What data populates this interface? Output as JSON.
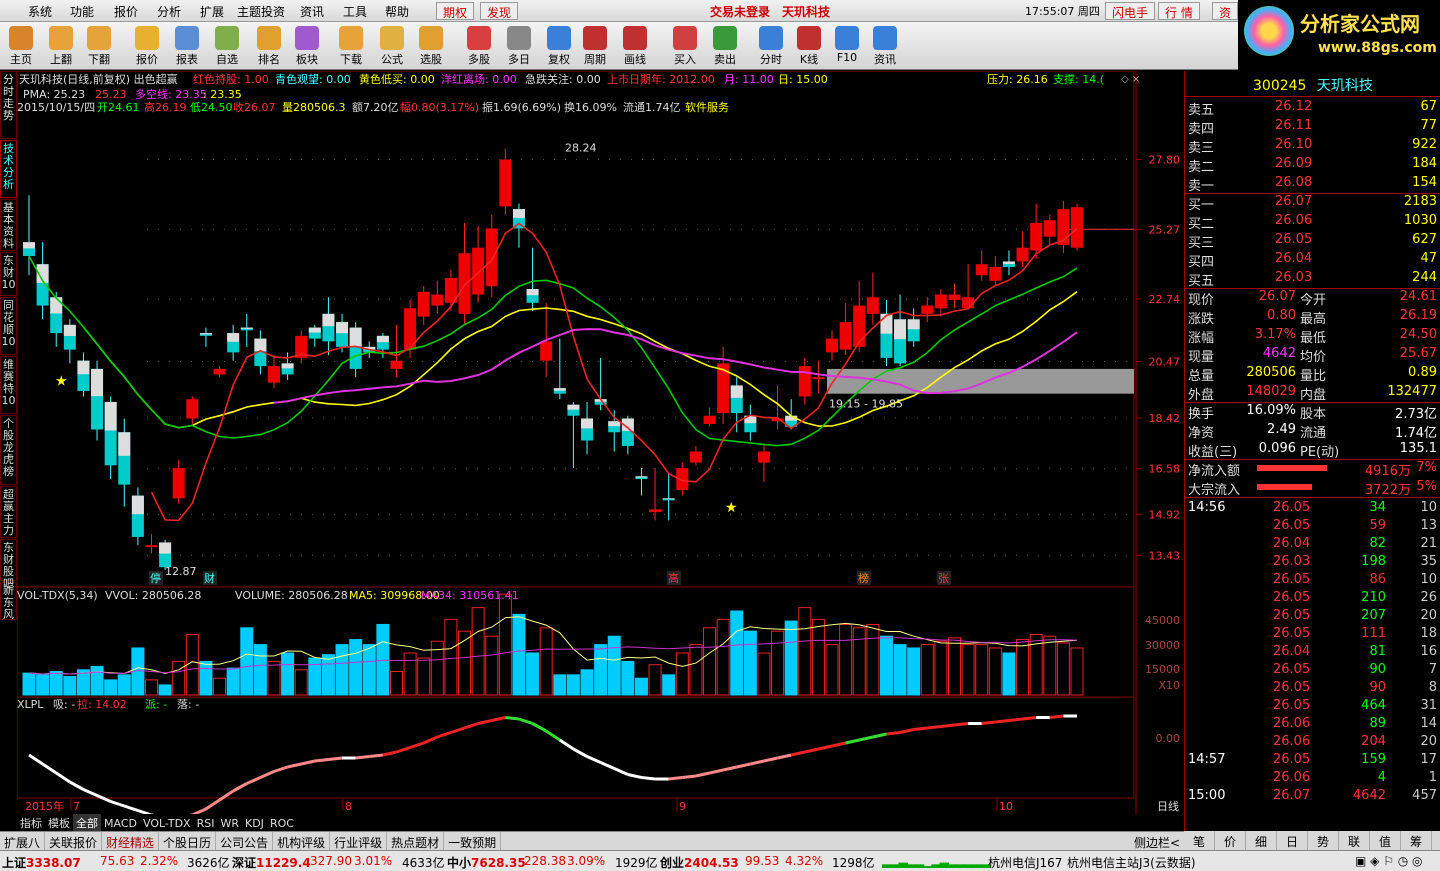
{
  "menu": {
    "items": [
      "系统",
      "功能",
      "报价",
      "分析",
      "扩展",
      "主题投资",
      "资讯",
      "工具",
      "帮助"
    ],
    "qq": "期权",
    "fx": "发现",
    "login": "交易未登录",
    "stock": "天玑科技",
    "time": "17:55:07 周四",
    "btn1": "闪电手",
    "btn2": "行 情",
    "btn3": "资"
  },
  "toolbar": [
    "主页",
    "上翻",
    "下翻",
    "报价",
    "报表",
    "自选",
    "排名",
    "板块",
    "下载",
    "公式",
    "选股",
    "多股",
    "多日",
    "复权",
    "周期",
    "画线",
    "买入",
    "卖出",
    "分时",
    "K线",
    "F10",
    "资讯"
  ],
  "logo": {
    "title": "分析家公式网",
    "url": "www.88gs.com"
  },
  "left_tabs": [
    "分时走势",
    "技术分析",
    "基本资料",
    "东财10",
    "同花顺10",
    "维赛特10",
    "个股龙虎榜",
    "超赢主力",
    "东财股吧",
    "新东风"
  ],
  "header": {
    "line1": "天玑科技(日线,前复权) 出色超赢",
    "hold": "红色持股: 1.00",
    "watch": "青色观望: 0.00",
    "low": "黄色低买: 0.00",
    "warn": "洋红离场: 0.00",
    "jump": "急跌关注: 0.00",
    "ipo": "上市日期年: 2012.00",
    "month": "月: 11.00",
    "day": "日: 15.00",
    "pressure": "压力: 26.16",
    "support": "支撑: 14.(",
    "pma": "PMA: 25.23",
    "v2": "25.23",
    "dk": "多空线: 23.35",
    "dk2": ": 23.35"
  },
  "infoline": {
    "date": "2015/10/15/四",
    "open": "开24.61",
    "high": "高26.19",
    "low": "低24.50",
    "close": "收26.07",
    "vol": "量280506.3",
    "amt": "额7.20亿",
    "pct": "幅0.80(3.17%)",
    "amp": "振1.69(6.69%)",
    "turn": "换16.09%",
    "float": "流通1.74亿",
    "sector": "软件服务"
  },
  "axis_prices": [
    "27.80",
    "25.27",
    "22.74",
    "20.47",
    "18.42",
    "16.58",
    "14.92",
    "13.43"
  ],
  "annotations": {
    "top": "28.24",
    "bottom": "12.87",
    "zone": "19.15 - 19.85",
    "marks": [
      "停",
      "财",
      "高",
      "榜",
      "张"
    ]
  },
  "vol_header": {
    "title": "VOL-TDX(5,34)",
    "vvol": "VVOL: 280506.28",
    "volume": "VOLUME: 280506.28",
    "ma5": "MA5: 309968.00",
    "ma34": "MA34: 310561.41"
  },
  "vol_axis": [
    "45000",
    "30000",
    "15000",
    "X10"
  ],
  "xlpl_header": {
    "title": "XLPL",
    "xi": "吸: -",
    "la": "拉: 14.02",
    "pai": "派: -",
    "luo": "落: -"
  },
  "xlpl_axis": "0.00",
  "date_axis": [
    "2015年",
    "7",
    "8",
    "9",
    "10"
  ],
  "date_label": "日线",
  "quote": {
    "code": "300245",
    "name": "天玑科技",
    "asks": [
      [
        "卖五",
        "26.12",
        "67"
      ],
      [
        "卖四",
        "26.11",
        "77"
      ],
      [
        "卖三",
        "26.10",
        "922"
      ],
      [
        "卖二",
        "26.09",
        "184"
      ],
      [
        "卖一",
        "26.08",
        "154"
      ]
    ],
    "bids": [
      [
        "买一",
        "26.07",
        "2183"
      ],
      [
        "买二",
        "26.06",
        "1030"
      ],
      [
        "买三",
        "26.05",
        "627"
      ],
      [
        "买四",
        "26.04",
        "47"
      ],
      [
        "买五",
        "26.03",
        "244"
      ]
    ],
    "stats": [
      [
        "现价",
        "26.07",
        "今开",
        "24.61"
      ],
      [
        "涨跌",
        "0.80",
        "最高",
        "26.19"
      ],
      [
        "涨幅",
        "3.17%",
        "最低",
        "24.50"
      ],
      [
        "现量",
        "4642",
        "均价",
        "25.67"
      ],
      [
        "总量",
        "280506",
        "量比",
        "0.89"
      ],
      [
        "外盘",
        "148029",
        "内盘",
        "132477"
      ]
    ],
    "stats2": [
      [
        "换手",
        "16.09%",
        "股本",
        "2.73亿"
      ],
      [
        "净资",
        "2.49",
        "流通",
        "1.74亿"
      ],
      [
        "收益(三)",
        "0.096",
        "PE(动)",
        "135.1"
      ]
    ],
    "flows": [
      [
        "净流入额",
        "4916万",
        "7%"
      ],
      [
        "大宗流入",
        "3722万",
        "5%"
      ]
    ],
    "ticks": [
      [
        "14:56",
        "26.05",
        "34",
        "10"
      ],
      [
        "",
        "26.05",
        "59",
        "13"
      ],
      [
        "",
        "26.04",
        "82",
        "21"
      ],
      [
        "",
        "26.03",
        "198",
        "35"
      ],
      [
        "",
        "26.05",
        "86",
        "10"
      ],
      [
        "",
        "26.05",
        "210",
        "26"
      ],
      [
        "",
        "26.05",
        "207",
        "20"
      ],
      [
        "",
        "26.05",
        "111",
        "18"
      ],
      [
        "",
        "26.04",
        "81",
        "16"
      ],
      [
        "",
        "26.05",
        "90",
        "7"
      ],
      [
        "",
        "26.05",
        "90",
        "8"
      ],
      [
        "",
        "26.05",
        "464",
        "31"
      ],
      [
        "",
        "26.06",
        "89",
        "14"
      ],
      [
        "",
        "26.06",
        "204",
        "20"
      ],
      [
        "14:57",
        "26.05",
        "159",
        "17"
      ],
      [
        "",
        "26.06",
        "4",
        "1"
      ],
      [
        "15:00",
        "26.07",
        "4642",
        "457"
      ]
    ]
  },
  "bottom_tabs": [
    "指标",
    "模板",
    "全部",
    "MACD",
    "VOL-TDX",
    "RSI",
    "WR",
    "KDJ",
    "ROC"
  ],
  "func_tabs": [
    "扩展八",
    "关联报价",
    "财经精选",
    "个股日历",
    "公司公告",
    "机构评级",
    "行业评级",
    "热点题材",
    "一致预期"
  ],
  "side_label": "侧边栏<",
  "right_tabs": [
    "笔",
    "价",
    "细",
    "日",
    "势",
    "联",
    "值",
    "筹"
  ],
  "status": {
    "sh": "上证",
    "sh_v": "3338.07",
    "sh_c": "75.63",
    "sh_p": "2.32%",
    "sh_a": "3626亿",
    "sz": "深证",
    "sz_v": "11229.4",
    "sz_c": "327.90",
    "sz_p": "3.01%",
    "sz_a": "4633亿",
    "zx": "中小",
    "zx_v": "7628.35",
    "zx_c": "228.38",
    "zx_p": "3.09%",
    "zx_a": "1929亿",
    "cy": "创业",
    "cy_v": "2404.53",
    "cy_c": "99.53",
    "cy_p": "4.32%",
    "cy_a": "1298亿",
    "srv1": "杭州电信J167",
    "srv2": "杭州电信主站J3(云数据)"
  },
  "chart_data": {
    "type": "candlestick",
    "price_range": [
      12.5,
      29.2
    ],
    "candles": [
      [
        24.8,
        24.3,
        26.5,
        23.6,
        "c"
      ],
      [
        24.0,
        22.5,
        24.8,
        22.0,
        "c"
      ],
      [
        22.8,
        21.5,
        23.0,
        21.0,
        "c"
      ],
      [
        21.8,
        20.9,
        22.0,
        20.4,
        "c"
      ],
      [
        20.5,
        19.4,
        20.8,
        19.2,
        "c"
      ],
      [
        20.2,
        18.0,
        20.5,
        17.6,
        "c"
      ],
      [
        19.0,
        16.7,
        19.2,
        16.2,
        "c"
      ],
      [
        17.9,
        16.0,
        18.4,
        15.2,
        "c"
      ],
      [
        15.6,
        14.1,
        15.9,
        13.8,
        "c"
      ],
      [
        13.8,
        13.8,
        14.2,
        13.5,
        "r"
      ],
      [
        13.9,
        13.0,
        14.0,
        12.9,
        "c"
      ],
      [
        15.5,
        16.6,
        16.9,
        15.3,
        "r"
      ],
      [
        18.4,
        19.1,
        19.2,
        18.2,
        "r"
      ],
      [
        21.5,
        21.4,
        21.7,
        21.0,
        "c"
      ],
      [
        20.0,
        20.2,
        20.3,
        19.9,
        "r"
      ],
      [
        21.5,
        20.8,
        21.8,
        20.5,
        "c"
      ],
      [
        21.7,
        21.6,
        22.2,
        21.0,
        "c"
      ],
      [
        21.3,
        20.3,
        21.6,
        20.0,
        "c"
      ],
      [
        19.7,
        20.3,
        20.7,
        19.5,
        "r"
      ],
      [
        20.4,
        20.0,
        20.8,
        19.8,
        "c"
      ],
      [
        20.6,
        21.4,
        21.6,
        20.4,
        "r"
      ],
      [
        21.7,
        21.3,
        21.8,
        21.0,
        "c"
      ],
      [
        22.2,
        21.2,
        22.8,
        20.7,
        "c"
      ],
      [
        21.9,
        21.0,
        22.2,
        20.8,
        "c"
      ],
      [
        21.7,
        20.2,
        21.9,
        19.9,
        "c"
      ],
      [
        21.0,
        20.8,
        21.2,
        20.6,
        "c"
      ],
      [
        21.4,
        20.9,
        21.5,
        20.6,
        "c"
      ],
      [
        20.2,
        20.5,
        21.8,
        19.9,
        "r"
      ],
      [
        20.9,
        22.4,
        22.7,
        20.6,
        "r"
      ],
      [
        22.1,
        23.0,
        23.2,
        21.8,
        "r"
      ],
      [
        22.5,
        22.9,
        23.4,
        22.2,
        "r"
      ],
      [
        22.6,
        23.5,
        23.8,
        22.3,
        "r"
      ],
      [
        22.2,
        24.4,
        25.5,
        21.8,
        "r"
      ],
      [
        22.9,
        24.6,
        25.4,
        22.6,
        "r"
      ],
      [
        23.2,
        25.3,
        25.8,
        22.8,
        "r"
      ],
      [
        26.1,
        27.8,
        28.2,
        25.8,
        "r"
      ],
      [
        26.0,
        25.3,
        26.2,
        24.6,
        "c"
      ],
      [
        23.1,
        22.6,
        24.6,
        22.3,
        "c"
      ],
      [
        20.5,
        21.2,
        22.6,
        19.9,
        "r"
      ],
      [
        19.5,
        19.3,
        21.3,
        19.1,
        "c"
      ],
      [
        18.9,
        18.5,
        19.0,
        16.6,
        "c"
      ],
      [
        18.4,
        17.6,
        19.0,
        17.1,
        "c"
      ],
      [
        19.1,
        18.9,
        20.6,
        18.7,
        "c"
      ],
      [
        18.3,
        17.9,
        18.7,
        17.2,
        "c"
      ],
      [
        18.4,
        17.4,
        18.5,
        17.1,
        "c"
      ],
      [
        16.3,
        16.2,
        16.6,
        15.6,
        "c"
      ],
      [
        15.1,
        15.0,
        16.6,
        14.7,
        "r"
      ],
      [
        15.5,
        15.5,
        16.4,
        14.7,
        "c"
      ],
      [
        15.8,
        16.6,
        16.8,
        15.6,
        "r"
      ],
      [
        16.8,
        17.2,
        17.4,
        16.7,
        "r"
      ],
      [
        18.2,
        18.5,
        18.8,
        18.1,
        "r"
      ],
      [
        18.6,
        20.4,
        21.0,
        18.2,
        "r"
      ],
      [
        19.6,
        18.6,
        19.9,
        17.9,
        "c"
      ],
      [
        18.5,
        17.9,
        18.9,
        17.6,
        "c"
      ],
      [
        17.2,
        16.8,
        17.5,
        16.1,
        "r"
      ],
      [
        18.3,
        18.4,
        19.6,
        18.0,
        "r"
      ],
      [
        18.1,
        18.5,
        19.1,
        18.0,
        "c"
      ],
      [
        19.2,
        20.3,
        20.6,
        18.9,
        "r"
      ],
      [
        19.9,
        19.9,
        20.5,
        19.3,
        "r"
      ],
      [
        20.8,
        21.3,
        21.6,
        20.5,
        "r"
      ],
      [
        20.9,
        21.9,
        22.6,
        20.7,
        "r"
      ],
      [
        21.0,
        22.5,
        23.4,
        20.8,
        "r"
      ],
      [
        22.2,
        22.8,
        23.7,
        21.8,
        "r"
      ],
      [
        20.6,
        22.2,
        22.7,
        20.3,
        "c"
      ],
      [
        20.4,
        22.0,
        22.9,
        20.3,
        "c"
      ],
      [
        22.0,
        21.2,
        22.4,
        21.0,
        "c"
      ],
      [
        22.2,
        22.5,
        22.8,
        21.9,
        "r"
      ],
      [
        22.4,
        22.9,
        23.1,
        22.1,
        "r"
      ],
      [
        22.7,
        22.9,
        23.3,
        22.4,
        "r"
      ],
      [
        22.8,
        22.4,
        24.0,
        22.5,
        "r"
      ],
      [
        23.6,
        24.0,
        24.5,
        23.4,
        "r"
      ],
      [
        23.4,
        23.9,
        24.3,
        23.2,
        "r"
      ],
      [
        24.1,
        23.9,
        24.5,
        23.6,
        "c"
      ],
      [
        24.1,
        24.6,
        25.2,
        23.9,
        "r"
      ],
      [
        24.5,
        25.5,
        26.2,
        24.2,
        "r"
      ],
      [
        25.0,
        25.6,
        25.8,
        24.7,
        "r"
      ],
      [
        26.0,
        24.7,
        26.3,
        24.4,
        "r"
      ],
      [
        24.6,
        26.07,
        26.19,
        24.5,
        "r"
      ]
    ]
  }
}
